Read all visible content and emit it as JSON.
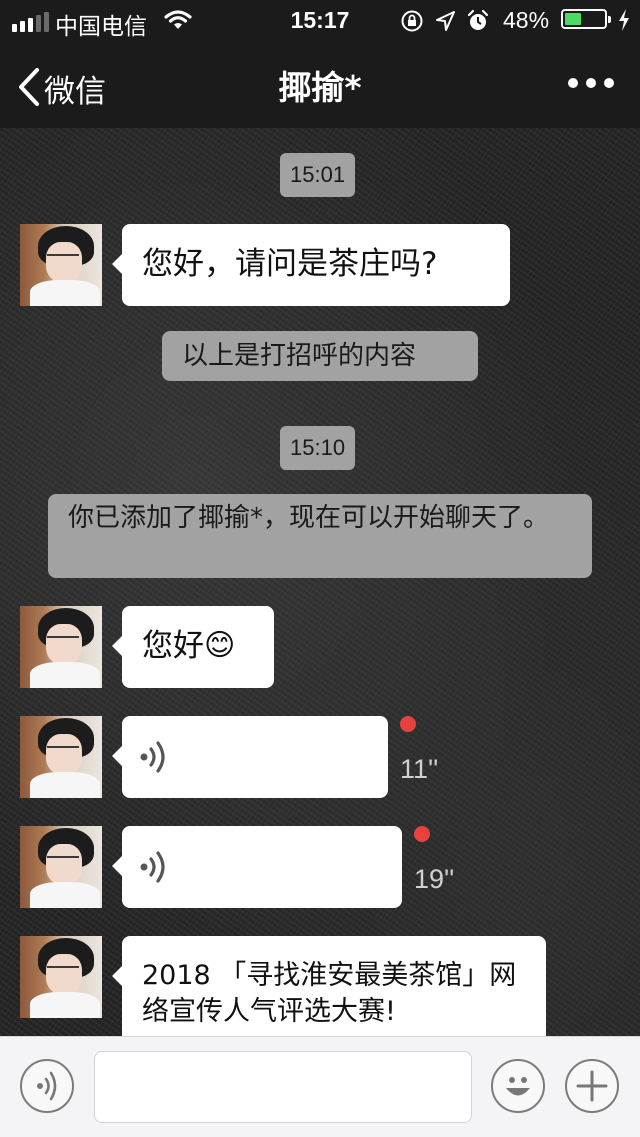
{
  "status_bar": {
    "carrier": "中国电信",
    "time": "15:17",
    "battery_percent": "48%",
    "battery_level": 0.48,
    "icons": [
      "signal-icon",
      "wifi-icon",
      "orientation-lock-icon",
      "location-arrow-icon",
      "alarm-icon",
      "battery-icon",
      "charging-bolt-icon"
    ]
  },
  "nav": {
    "back_label": "微信",
    "title": "揶揄*",
    "more_icon": "more-dots-icon"
  },
  "messages": {
    "time1": "15:01",
    "msg1": "您好，请问是茶庄吗?",
    "system1": "以上是打招呼的内容",
    "time2": "15:10",
    "system2": "你已添加了揶揄*，现在可以开始聊天了。",
    "msg2_text": "您好",
    "msg2_emoji": "😊",
    "voice1_duration": "11''",
    "voice2_duration": "19''",
    "card_title": "2018 「寻找淮安最美茶馆」网络宣传人气评选大赛!"
  },
  "input_bar": {
    "voice_icon": "voice-input-icon",
    "emoji_icon": "emoji-icon",
    "plus_icon": "plus-icon",
    "placeholder": ""
  },
  "colors": {
    "bar_bg": "#1b1b1b",
    "bubble_bg": "#ffffff",
    "pill_bg": "#a2a2a2",
    "unread_dot": "#e64340",
    "battery_fill": "#4cd964"
  }
}
